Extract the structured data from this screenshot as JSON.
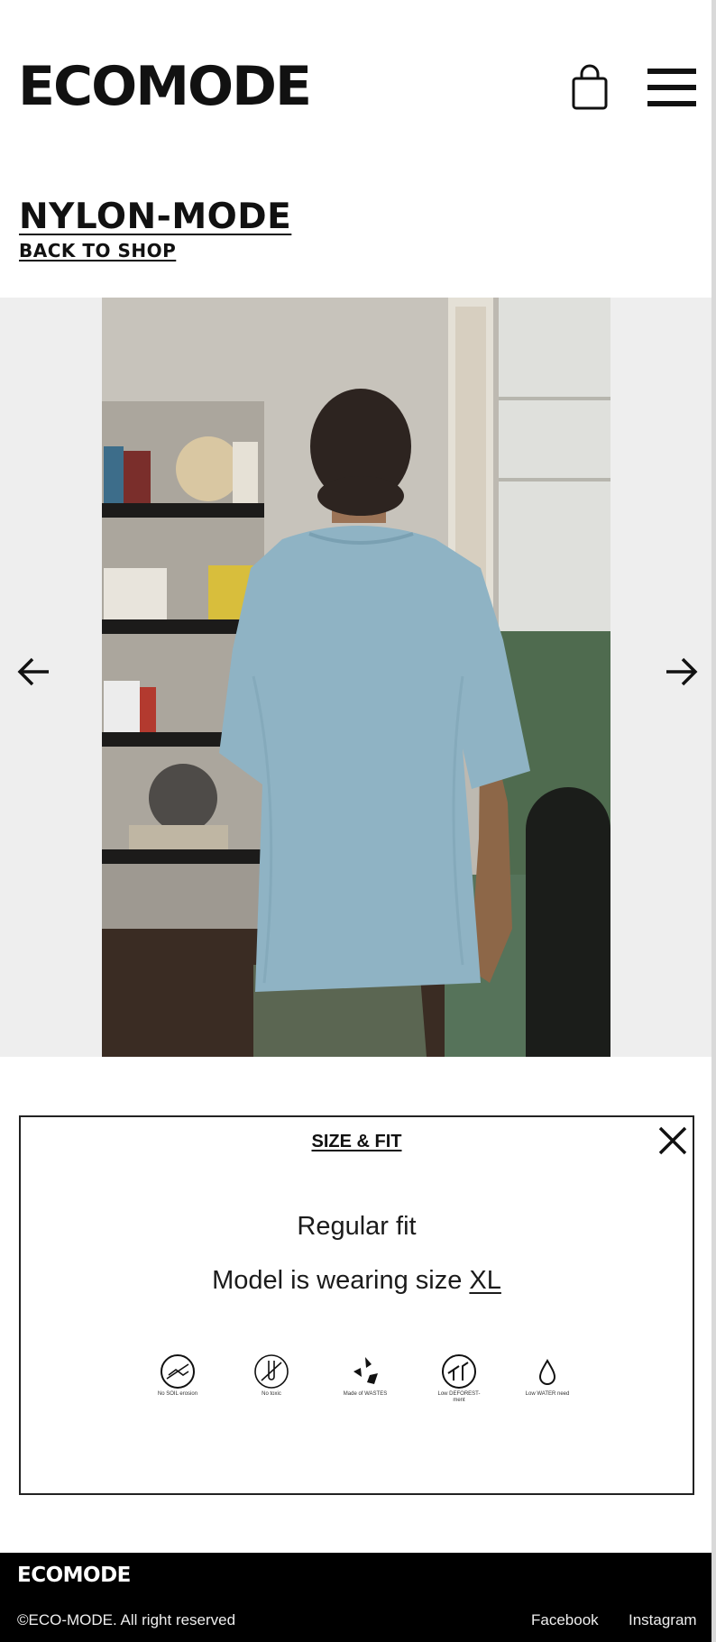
{
  "header": {
    "logo": "ECOMODE",
    "cart_icon": "shopping-bag-icon",
    "menu_icon": "hamburger-menu-icon"
  },
  "product": {
    "title": "NYLON-MODE",
    "back_link": "BACK TO SHOP"
  },
  "gallery": {
    "prev_icon": "arrow-left-icon",
    "next_icon": "arrow-right-icon",
    "image_alt": "Model from behind wearing light blue t-shirt"
  },
  "size_fit": {
    "title": "SIZE & FIT",
    "close_icon": "close-icon",
    "fit": "Regular fit",
    "model_prefix": "Model is wearing size ",
    "model_size": "XL",
    "eco_icons": [
      {
        "icon": "no-soil-erosion-icon",
        "caption": "No SOIL erosion"
      },
      {
        "icon": "no-toxic-icon",
        "caption": "No toxic"
      },
      {
        "icon": "made-of-waste-icon",
        "caption": "Made of WASTES"
      },
      {
        "icon": "low-deforestation-icon",
        "caption": "Low DEFOREST-ment"
      },
      {
        "icon": "water-drop-icon",
        "caption": "Low WATER need"
      }
    ]
  },
  "footer": {
    "logo": "ECOMODE",
    "copyright": "©ECO-MODE. All right reserved",
    "links": [
      "Facebook",
      "Instagram"
    ]
  },
  "colors": {
    "text": "#111111",
    "gallery_bg": "#eeeeee",
    "footer_bg": "#000000",
    "shirt": "#8fb3c4"
  }
}
